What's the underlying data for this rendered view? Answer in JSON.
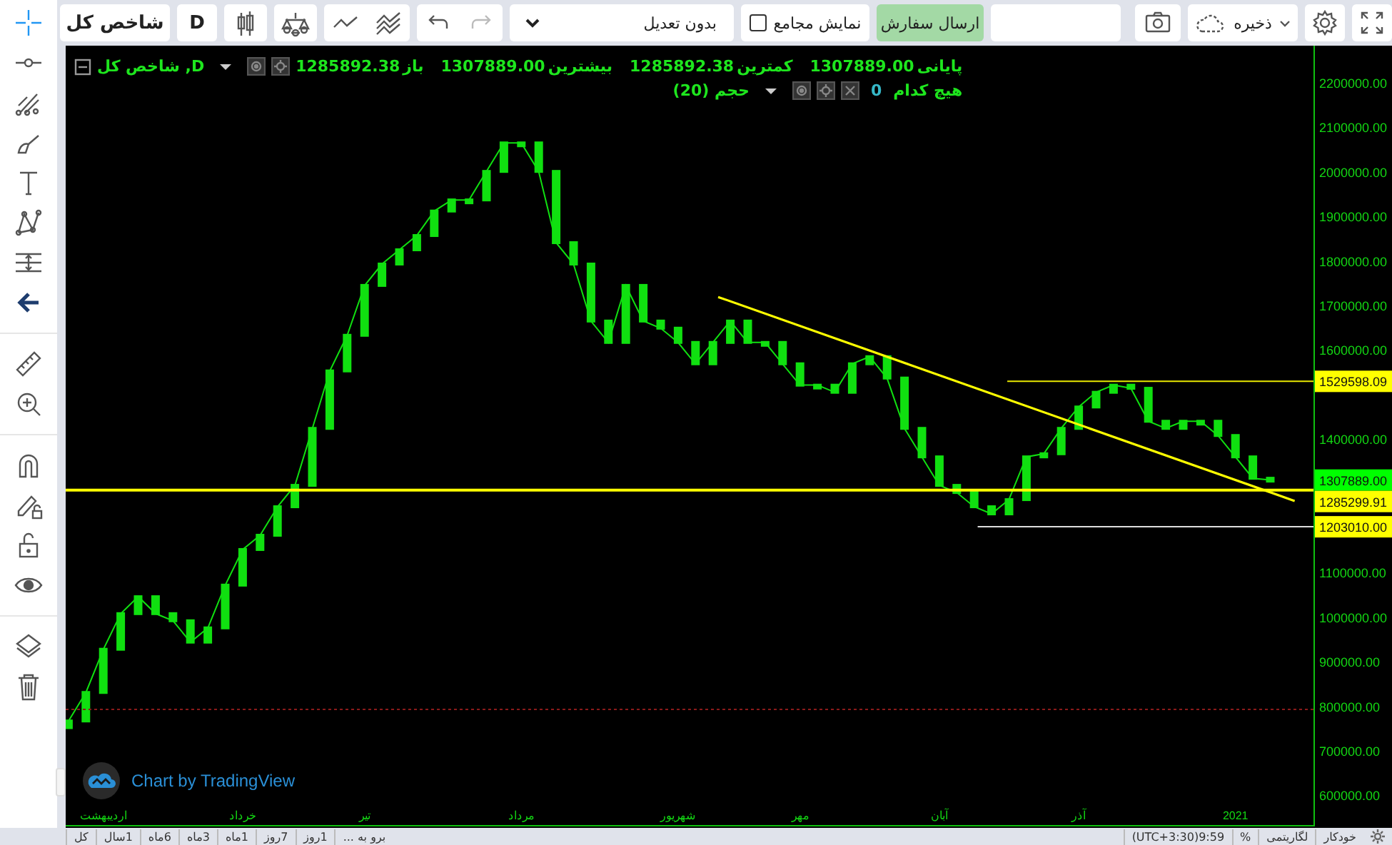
{
  "tool_groups": [
    {
      "tools": [
        {
          "kind": "crosshair",
          "selected": true
        },
        {
          "kind": "line",
          "selected": false
        },
        {
          "kind": "fork",
          "selected": false
        },
        {
          "kind": "brush",
          "selected": false
        },
        {
          "kind": "text",
          "selected": false
        },
        {
          "kind": "pattern",
          "selected": false
        },
        {
          "kind": "measure",
          "selected": false
        },
        {
          "kind": "arrow",
          "selected": false
        }
      ]
    },
    {
      "tools": [
        {
          "kind": "ruler",
          "selected": false
        },
        {
          "kind": "zoom",
          "selected": false
        }
      ]
    },
    {
      "tools": [
        {
          "kind": "magnet",
          "selected": false
        },
        {
          "kind": "pencil-lock",
          "selected": false
        },
        {
          "kind": "lock",
          "selected": false
        },
        {
          "kind": "eye",
          "selected": false
        }
      ]
    },
    {
      "tools": [
        {
          "kind": "layers",
          "selected": false
        },
        {
          "kind": "trash",
          "selected": false
        }
      ]
    }
  ],
  "toolbar": {
    "symbol": "شاخص کل",
    "interval": "D",
    "adjustment": "بدون تعدیل",
    "show_meetings": {
      "label": "نمایش مجامع",
      "checked": false
    },
    "order_button": "ارسال سفارش",
    "save_button": "ذخیره"
  },
  "legend": {
    "values": [
      {
        "label": "پایانی",
        "value": "1307889.00"
      },
      {
        "label": "کمترین",
        "value": "1285892.38"
      },
      {
        "label": "بیشترین",
        "value": "1307889.00"
      },
      {
        "label": "باز",
        "value": "1285892.38"
      }
    ],
    "title": "D, شاخص کل",
    "study": {
      "source": "هیچ کدام",
      "value": "0",
      "title": "حجم (20)"
    }
  },
  "chart": {
    "chart_data": {
      "type": "line",
      "categories": [
        null,
        null,
        "اردیبهشت",
        null,
        null,
        null,
        null,
        null,
        null,
        null,
        "خرداد",
        null,
        null,
        null,
        null,
        null,
        null,
        "تیر",
        null,
        null,
        null,
        null,
        null,
        null,
        null,
        null,
        "مرداد",
        null,
        null,
        null,
        null,
        null,
        null,
        null,
        null,
        "شهریور",
        null,
        null,
        null,
        null,
        null,
        null,
        "مهر",
        null,
        null,
        null,
        null,
        null,
        null,
        null,
        "آبان",
        null,
        null,
        null,
        null,
        null,
        null,
        null,
        "آذر",
        null,
        null,
        null,
        null,
        null,
        null,
        null,
        null,
        "2021",
        null,
        null
      ],
      "series": [
        {
          "color": "#10e010",
          "values": [
            767000,
            831000,
            928000,
            1008000,
            1046000,
            1008000,
            992000,
            944000,
            976000,
            1072000,
            1152000,
            1184000,
            1248000,
            1296000,
            1424000,
            1553000,
            1633000,
            1745000,
            1793000,
            1825000,
            1857000,
            1912000,
            1937000,
            1937000,
            2001000,
            2065000,
            2065000,
            2001000,
            1841000,
            1793000,
            1665000,
            1617000,
            1745000,
            1665000,
            1649000,
            1617000,
            1569000,
            1617000,
            1665000,
            1617000,
            1617000,
            1569000,
            1521000,
            1521000,
            1505000,
            1569000,
            1585000,
            1537000,
            1424000,
            1360000,
            1296000,
            1280000,
            1248000,
            1232000,
            1264000,
            1360000,
            1367000,
            1424000,
            1472000,
            1505000,
            1521000,
            1514000,
            1440000,
            1424000,
            1440000,
            1440000,
            1408000,
            1360000,
            1312000,
            1308000
          ]
        }
      ],
      "ylim": [
        533333,
        2283333
      ],
      "yticks": [
        {
          "value": 600000,
          "label": "600000.00"
        },
        {
          "value": 700000,
          "label": "700000.00"
        },
        {
          "value": 800000,
          "label": "800000.00"
        },
        {
          "value": 900000,
          "label": "900000.00"
        },
        {
          "value": 1000000,
          "label": "1000000.00"
        },
        {
          "value": 1100000,
          "label": "1100000.00"
        },
        {
          "value": 1400000,
          "label": "1400000.00"
        },
        {
          "value": 1600000,
          "label": "1600000.00"
        },
        {
          "value": 1700000,
          "label": "1700000.00"
        },
        {
          "value": 1800000,
          "label": "1800000.00"
        },
        {
          "value": 1900000,
          "label": "1900000.00"
        },
        {
          "value": 2000000,
          "label": "2000000.00"
        },
        {
          "value": 2100000,
          "label": "2100000.00"
        },
        {
          "value": 2200000,
          "label": "2200000.00"
        }
      ]
    },
    "drawings": [
      {
        "kind": "trendline"
      },
      {
        "kind": "ray",
        "label": "1529598.09",
        "color": "#ffff00"
      },
      {
        "kind": "price_tag",
        "label": "1307889.00",
        "color": "#00ff00"
      },
      {
        "kind": "hline",
        "label": "1285299.91",
        "color": "#ffff00"
      },
      {
        "kind": "ray_light",
        "label": "1203010.00",
        "color": "#ffff00"
      },
      {
        "kind": "dotted_line"
      }
    ],
    "attribution": "Chart by TradingView"
  },
  "bottom_bar": {
    "auto": "خودکار",
    "log": "لگاریتمی",
    "percent": "%",
    "clock": "(UTC+3:30)9:59",
    "goto": "برو به ...",
    "ranges": [
      "1روز",
      "7روز",
      "1ماه",
      "3ماه",
      "6ماه",
      "1سال",
      "کل"
    ]
  }
}
